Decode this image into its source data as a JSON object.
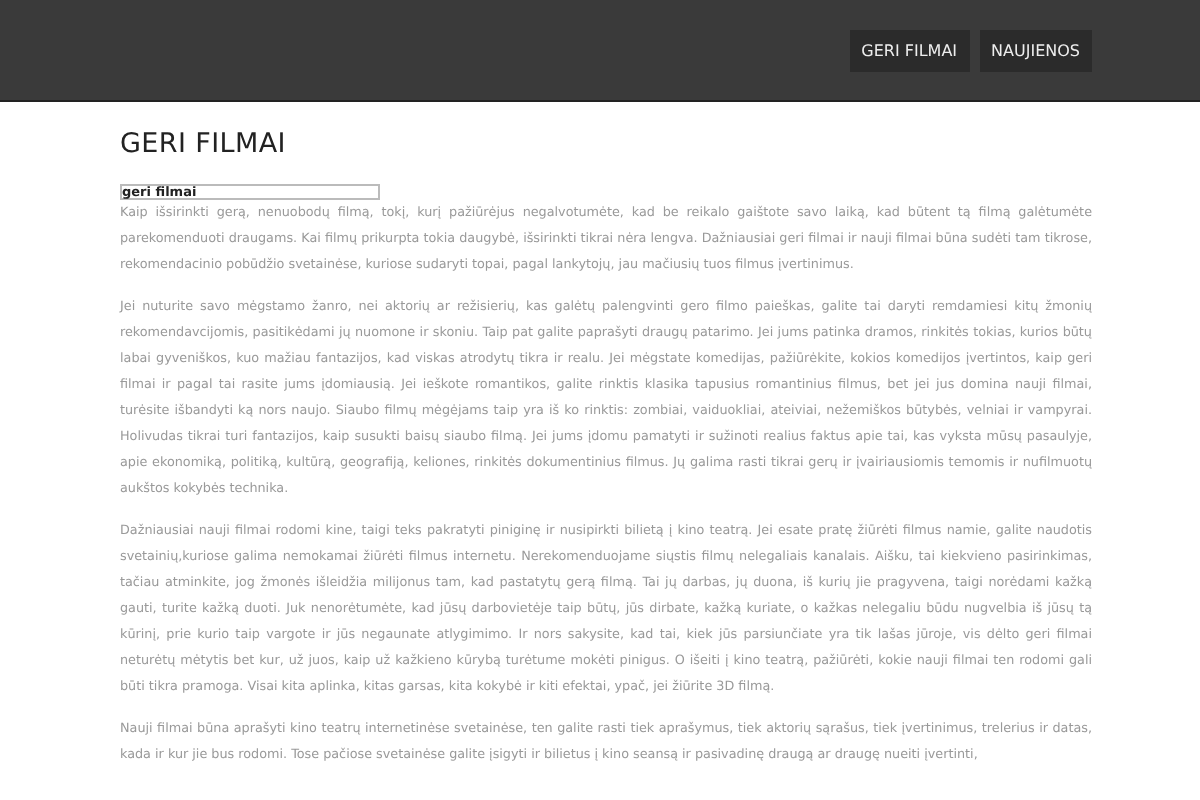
{
  "nav": [
    {
      "label": "GERI FILMAI"
    },
    {
      "label": "NAUJIENOS"
    }
  ],
  "page_title": "GERI FILMAI",
  "image_alt": "geri filmai",
  "paragraphs": [
    "Kaip išsirinkti gerą, nenuobodų filmą, tokį, kurį pažiūrėjus negalvotumėte, kad be reikalo gaištote savo laiką, kad būtent tą filmą galėtumėte parekomenduoti draugams. Kai filmų prikurpta tokia daugybė, išsirinkti tikrai nėra lengva. Dažniausiai geri filmai ir nauji filmai būna sudėti tam tikrose, rekomendacinio pobūdžio svetainėse, kuriose sudaryti topai, pagal lankytojų, jau mačiusių tuos filmus įvertinimus.",
    "Jei nuturite savo mėgstamo žanro, nei aktorių ar režisierių, kas galėtų palengvinti gero filmo paieškas, galite tai daryti remdamiesi kitų žmonių rekomendavcijomis, pasitikėdami jų nuomone ir skoniu. Taip pat galite paprašyti draugų patarimo. Jei jums patinka dramos, rinkitės tokias, kurios būtų labai gyveniškos, kuo mažiau fantazijos, kad viskas atrodytų tikra ir realu. Jei mėgstate komedijas, pažiūrėkite, kokios komedijos įvertintos, kaip geri filmai ir pagal tai rasite jums įdomiausią. Jei ieškote romantikos, galite rinktis klasika tapusius romantinius filmus, bet jei jus domina nauji filmai, turėsite išbandyti ką nors naujo. Siaubo filmų mėgėjams taip yra iš ko rinktis: zombiai, vaiduokliai, ateiviai, nežemiškos būtybės, velniai ir vampyrai. Holivudas tikrai turi fantazijos, kaip susukti baisų siaubo filmą. Jei jums įdomu pamatyti ir sužinoti realius faktus apie tai, kas vyksta mūsų pasaulyje, apie ekonomiką, politiką, kultūrą, geografiją, keliones, rinkitės dokumentinius filmus. Jų galima rasti tikrai gerų ir įvairiausiomis temomis ir nufilmuotų aukštos kokybės technika.",
    "Dažniausiai nauji filmai rodomi kine, taigi teks pakratyti piniginę ir nusipirkti bilietą į kino teatrą. Jei esate pratę žiūrėti filmus namie, galite naudotis svetainių,kuriose galima nemokamai žiūrėti filmus internetu. Nerekomenduojame siųstis filmų nelegaliais kanalais. Aišku, tai kiekvieno pasirinkimas, tačiau atminkite, jog žmonės išleidžia milijonus tam, kad pastatytų gerą filmą. Tai jų darbas, jų duona, iš kurių jie pragyvena, taigi norėdami kažką gauti, turite kažką duoti. Juk nenorėtumėte, kad jūsų darbovietėje taip būtų, jūs dirbate, kažką kuriate, o kažkas nelegaliu būdu nugvelbia iš jūsų tą kūrinį, prie kurio taip vargote ir jūs negaunate atlygimimo. Ir nors sakysite, kad tai, kiek jūs parsiunčiate yra tik lašas jūroje, vis dėlto geri filmai neturėtų mėtytis bet kur, už juos, kaip už kažkieno kūrybą turėtume mokėti pinigus. O išeiti į kino teatrą, pažiūrėti, kokie nauji filmai ten rodomi gali būti tikra pramoga. Visai kita aplinka, kitas garsas, kita kokybė ir kiti efektai, ypač, jei žiūrite 3D filmą.",
    "Nauji filmai būna aprašyti kino teatrų internetinėse svetainėse, ten galite rasti tiek aprašymus, tiek aktorių sąrašus, tiek įvertinimus, trelerius ir datas, kada ir kur jie bus rodomi. Tose pačiose svetainėse galite įsigyti ir bilietus į kino seansą ir pasivadinę draugą ar draugę nueiti įvertinti,"
  ]
}
